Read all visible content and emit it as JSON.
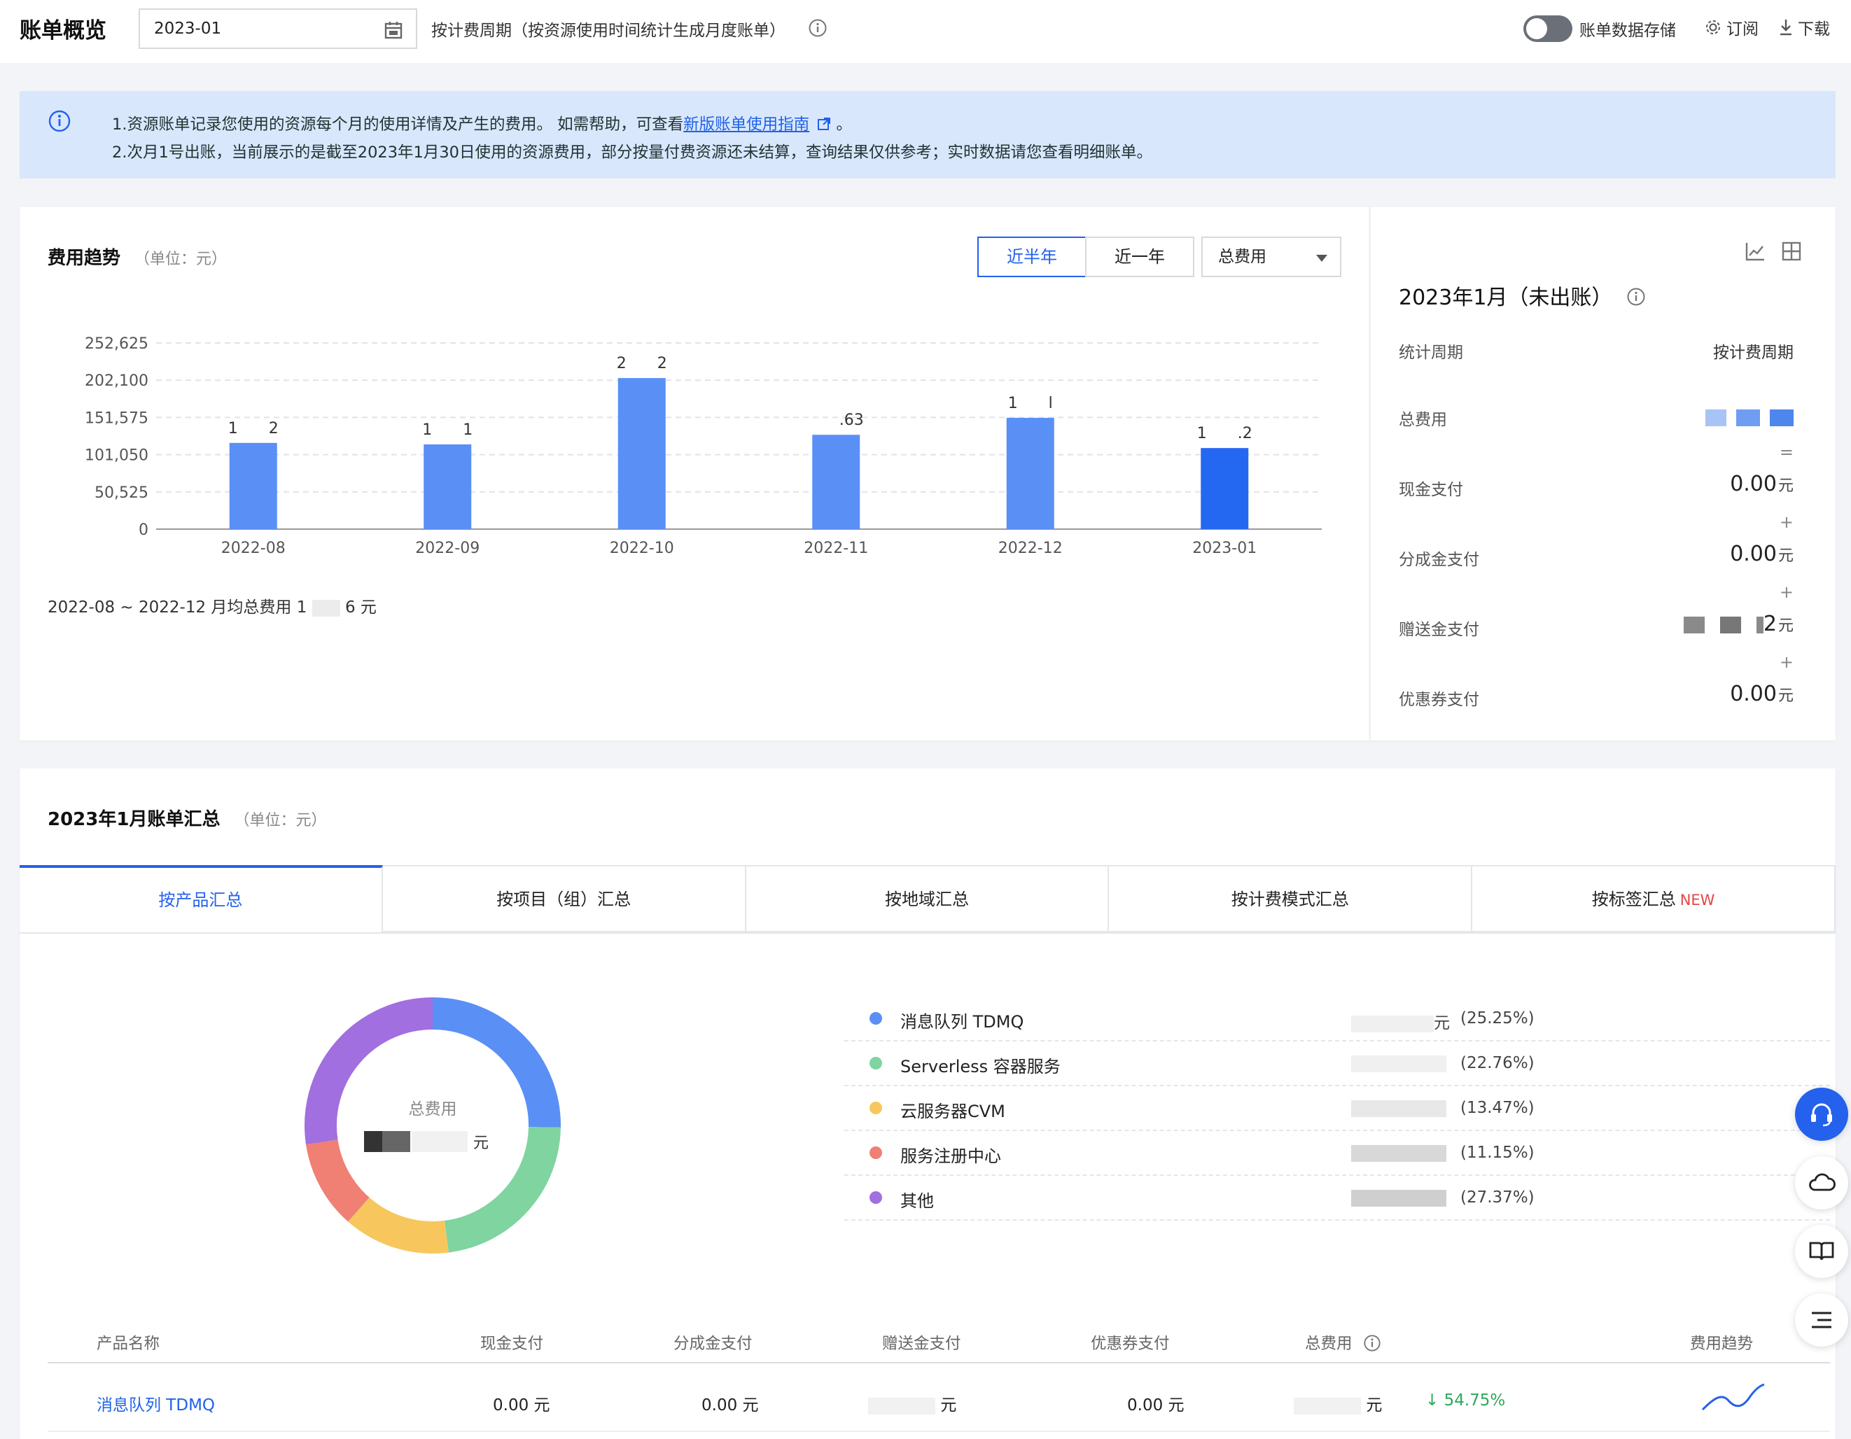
{
  "header": {
    "title": "账单概览",
    "date_value": "2023-01",
    "cycle_text": "按计费周期（按资源使用时间统计生成月度账单）",
    "storage_label": "账单数据存储",
    "subscribe_label": "订阅",
    "download_label": "下载"
  },
  "notice": {
    "line1_prefix": "1.资源账单记录您使用的资源每个月的使用详情及产生的费用。 如需帮助，可查看",
    "line1_link": "新版账单使用指南",
    "line1_suffix": " 。",
    "line2": "2.次月1号出账，当前展示的是截至2023年1月30日使用的资源费用，部分按量付费资源还未结算，查询结果仅供参考；实时数据请您查看明细账单。"
  },
  "trend": {
    "title": "费用趋势",
    "unit": "（单位：元）",
    "range_half": "近半年",
    "range_year": "近一年",
    "select_value": "总费用",
    "avg_prefix": "2022-08 ~ 2022-12 月均总费用 1",
    "avg_suffix": "6 元"
  },
  "chart_data": {
    "type": "bar",
    "categories": [
      "2022-08",
      "2022-09",
      "2022-10",
      "2022-11",
      "2022-12",
      "2023-01"
    ],
    "values": [
      117000,
      115000,
      205000,
      128000,
      151000,
      110000
    ],
    "bar_labels": [
      "1  2",
      "1  1",
      "2  2",
      "  .63",
      "1  l",
      "1  .2"
    ],
    "yticks": [
      "252,625",
      "202,100",
      "151,575",
      "101,050",
      "50,525",
      "0"
    ],
    "ylim": [
      0,
      252625
    ],
    "highlight_color": "#2468f2",
    "bar_color": "#5a8ff5",
    "grid": "dashed"
  },
  "side": {
    "month": "2023年1月（未出账）",
    "period_label": "统计周期",
    "period_value": "按计费周期",
    "total_label": "总费用",
    "eq": "=",
    "cash_label": "现金支付",
    "cash_value": "0.00",
    "split_label": "分成金支付",
    "split_value": "0.00",
    "gift_label": "赠送金支付",
    "gift_value_tail": "2",
    "coupon_label": "优惠券支付",
    "coupon_value": "0.00",
    "currency": "元",
    "plus": "+"
  },
  "summary": {
    "title": "2023年1月账单汇总",
    "unit": "（单位：元）",
    "tabs": [
      "按产品汇总",
      "按项目（组）汇总",
      "按地域汇总",
      "按计费模式汇总",
      "按标签汇总"
    ],
    "tab_new": "NEW",
    "donut_label": "总费用",
    "donut_value_tail": "元",
    "legend": [
      {
        "name": "消息队列 TDMQ",
        "pct": "(25.25%)",
        "color": "#5a8ff5",
        "amt_tail": "元"
      },
      {
        "name": "Serverless 容器服务",
        "pct": "(22.76%)",
        "color": "#7fd4a0",
        "amt_tail": ""
      },
      {
        "name": "云服务器CVM",
        "pct": "(13.47%)",
        "color": "#f7c75e",
        "amt_tail": ""
      },
      {
        "name": "服务注册中心",
        "pct": "(11.15%)",
        "color": "#f07f74",
        "amt_tail": ""
      },
      {
        "name": "其他",
        "pct": "(27.37%)",
        "color": "#a16fdf",
        "amt_tail": ""
      }
    ],
    "donut_shares": [
      25.25,
      22.76,
      13.47,
      11.15,
      27.37
    ],
    "table_headers": [
      "产品名称",
      "现金支付",
      "分成金支付",
      "赠送金支付",
      "优惠券支付",
      "总费用",
      "费用趋势"
    ],
    "row": {
      "name": "消息队列 TDMQ",
      "cash": "0.00 元",
      "split": "0.00 元",
      "gift": "元",
      "coupon": "0.00 元",
      "total": "元",
      "change": "↓ 54.75%"
    }
  }
}
